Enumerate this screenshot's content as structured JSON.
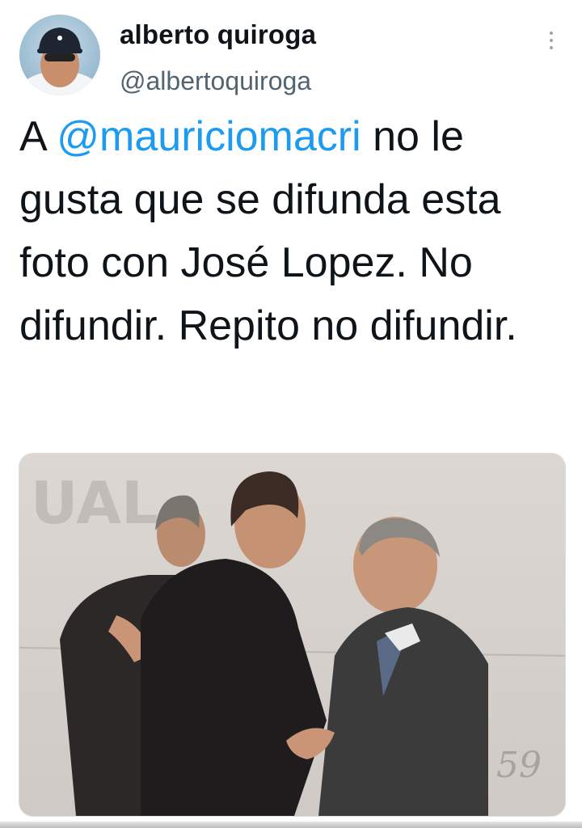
{
  "user": {
    "display_name": "alberto quiroga",
    "handle": "@albertoquiroga",
    "avatar_icon": "profile-photo"
  },
  "tweet": {
    "text_prefix": "A ",
    "mention": "@mauriciomacri",
    "text_rest": " no le gusta que se difunda esta foto con José Lopez. No difundir. Repito no difundir."
  },
  "media": {
    "background_text": "UAL",
    "corner_mark": "59"
  },
  "colors": {
    "mention": "#1d9bf0",
    "text": "#0f1419",
    "secondary_text": "#536471"
  },
  "icons": {
    "more": "more-vertical-icon"
  }
}
